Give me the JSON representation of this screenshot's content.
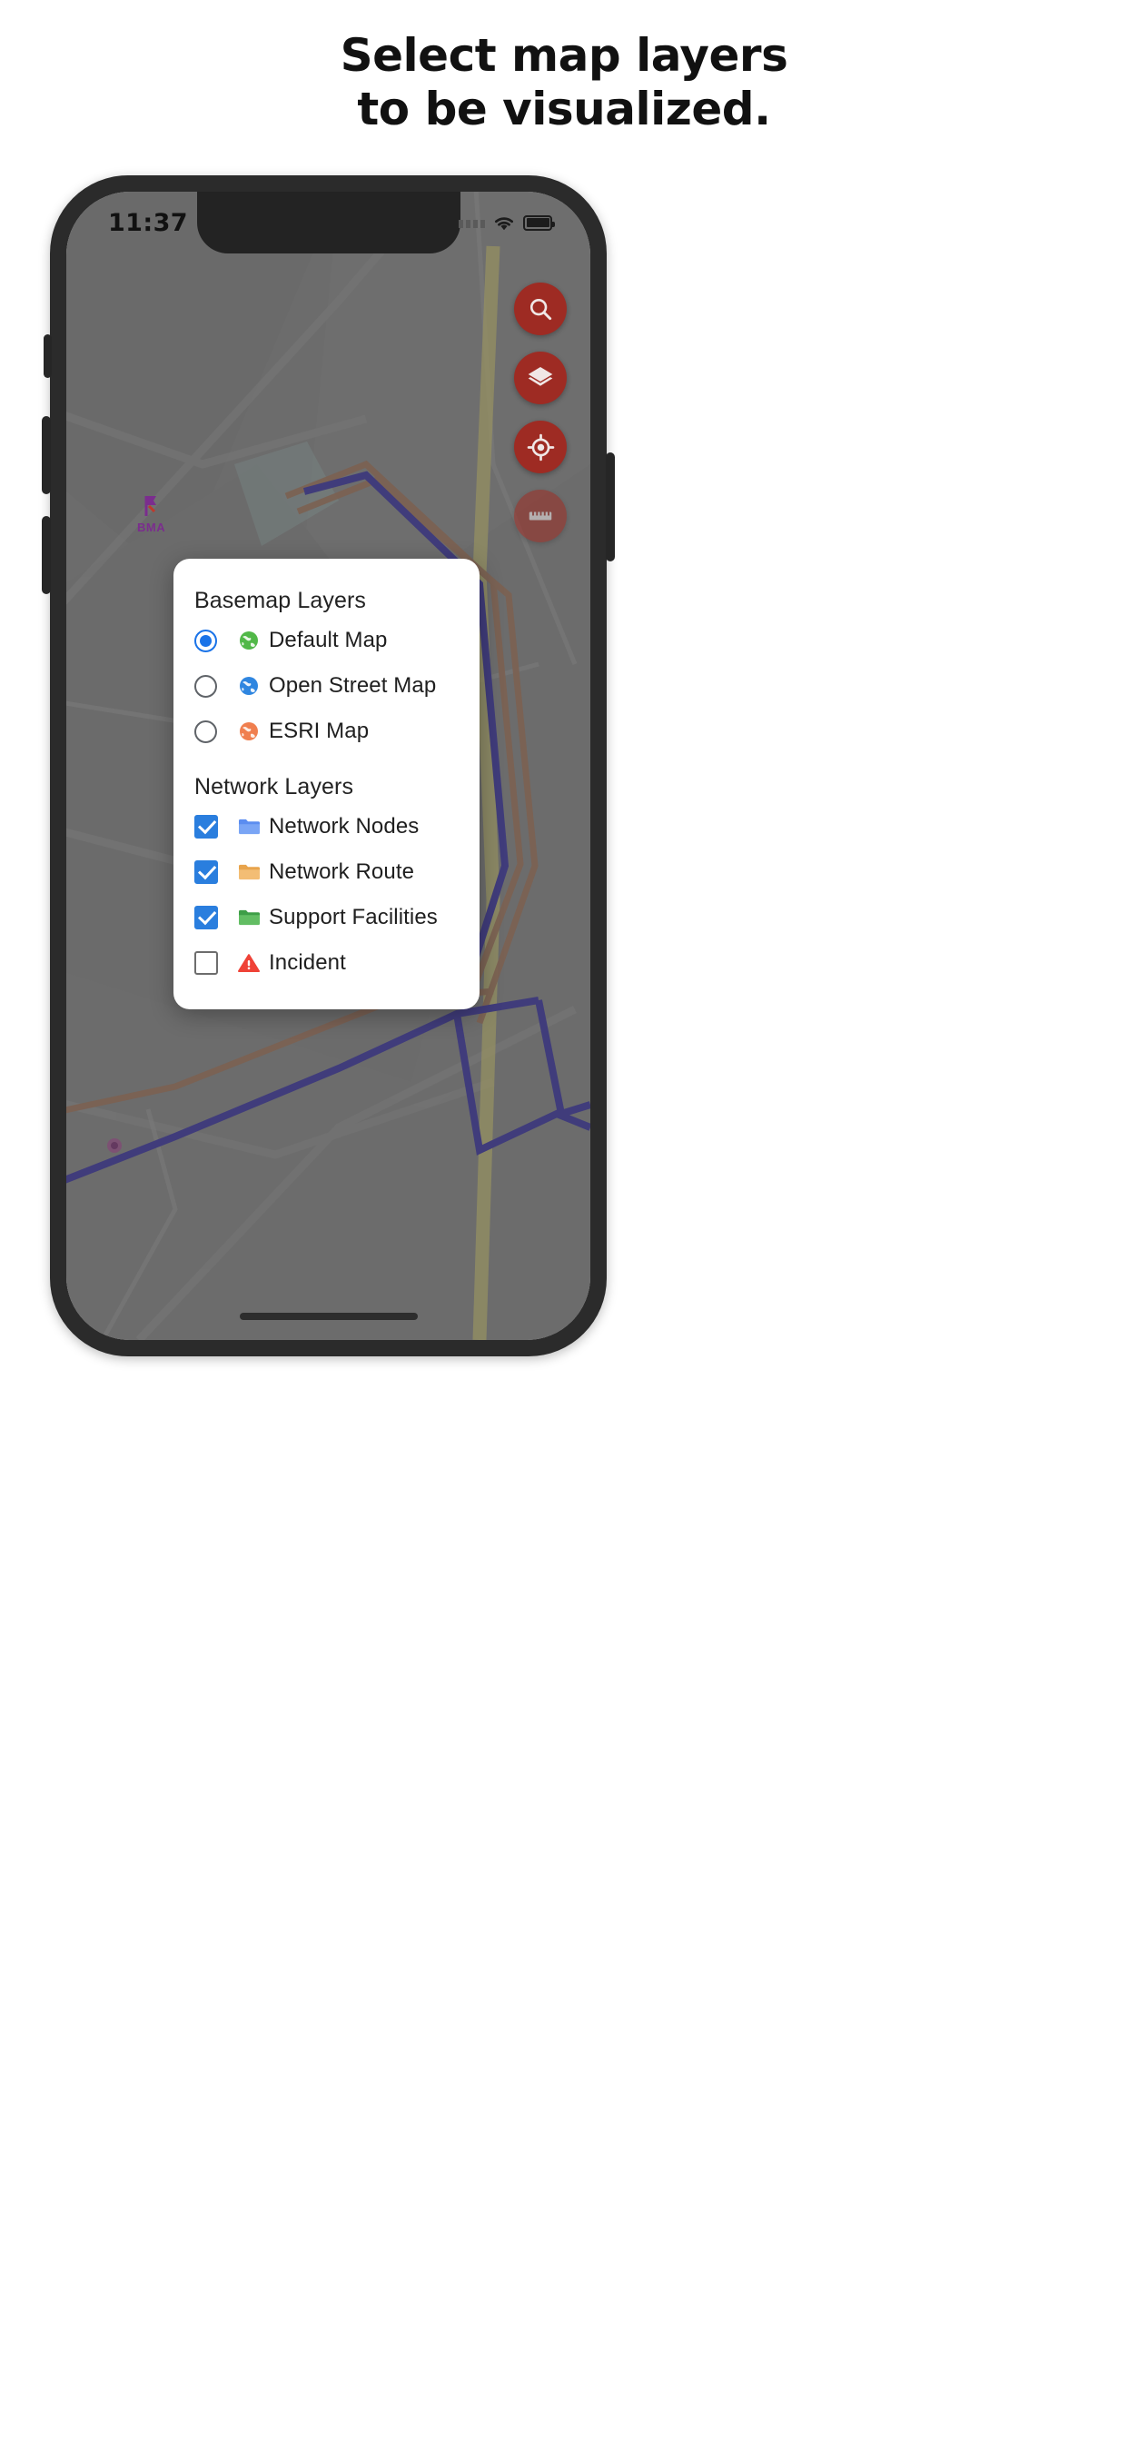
{
  "headline": {
    "line1": "Select map layers",
    "line2": "to be visualized."
  },
  "phone": {
    "status_bar": {
      "time": "11:37",
      "signal_icon": "signal-dots-icon",
      "wifi_icon": "wifi-icon",
      "battery_icon": "battery-full-icon"
    },
    "home_indicator": "home-indicator"
  },
  "map": {
    "marker_label": "BMA",
    "marker_icon": "flag-marker-icon",
    "colors": {
      "base": "#8a8a8a",
      "route_blue": "#3b35a8",
      "route_brown": "#a9785c",
      "road_yellow": "#d8cf7a",
      "dim_overlay": "#464646"
    }
  },
  "fabs": {
    "accent": "#9e2b23",
    "items": [
      {
        "name": "search-fab",
        "icon": "search-icon",
        "label": "Search",
        "dimmed": false
      },
      {
        "name": "layers-fab",
        "icon": "layers-icon",
        "label": "Layers",
        "dimmed": false
      },
      {
        "name": "my-location-fab",
        "icon": "my-location-icon",
        "label": "My Location",
        "dimmed": false
      },
      {
        "name": "measure-fab",
        "icon": "ruler-icon",
        "label": "Measure",
        "dimmed": true
      }
    ]
  },
  "dialog": {
    "basemap": {
      "title": "Basemap Layers",
      "options": [
        {
          "label": "Default Map",
          "icon": "globe-green-icon",
          "selected": true
        },
        {
          "label": "Open Street Map",
          "icon": "globe-blue-icon",
          "selected": false
        },
        {
          "label": "ESRI Map",
          "icon": "globe-orange-icon",
          "selected": false
        }
      ]
    },
    "network": {
      "title": "Network Layers",
      "options": [
        {
          "label": "Network Nodes",
          "icon": "folder-blue-icon",
          "checked": true
        },
        {
          "label": "Network Route",
          "icon": "folder-orange-icon",
          "checked": true
        },
        {
          "label": "Support Facilities",
          "icon": "folder-green-icon",
          "checked": true
        },
        {
          "label": "Incident",
          "icon": "warning-red-icon",
          "checked": false
        }
      ]
    },
    "colors": {
      "radio_selected": "#1a73e8",
      "checkbox_checked": "#2a7ede",
      "checkbox_unchecked_border": "#6d6d6d"
    }
  }
}
